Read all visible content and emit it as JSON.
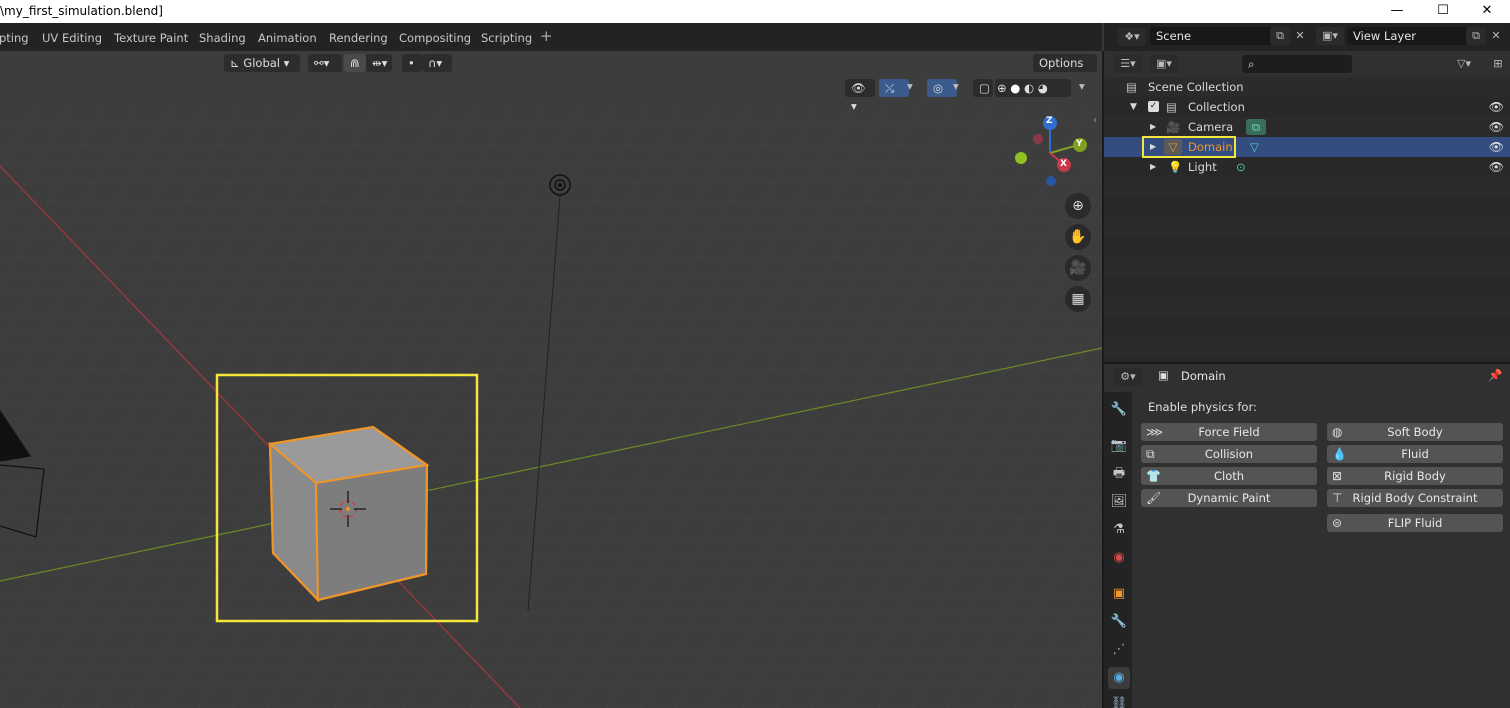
{
  "window": {
    "title": "\\my_first_simulation.blend]",
    "minimize": "—",
    "maximize": "☐",
    "close": "✕"
  },
  "workspace_tabs": [
    "pting",
    "UV Editing",
    "Texture Paint",
    "Shading",
    "Animation",
    "Rendering",
    "Compositing",
    "Scripting",
    "+"
  ],
  "scene": {
    "label": "Scene",
    "view_layer": "View Layer"
  },
  "viewport": {
    "transform_orientation": "Global",
    "options_label": "Options",
    "gizmo_axes": {
      "z": "Z",
      "y": "Y",
      "x": "X"
    }
  },
  "outliner": {
    "search_placeholder": "",
    "rows": [
      {
        "label": "Scene Collection"
      },
      {
        "label": "Collection"
      },
      {
        "label": "Camera"
      },
      {
        "label": "Domain"
      },
      {
        "label": "Light"
      }
    ]
  },
  "properties": {
    "object_name": "Domain",
    "enable_physics_label": "Enable physics for:",
    "left_buttons": [
      "Force Field",
      "Collision",
      "Cloth",
      "Dynamic Paint"
    ],
    "right_buttons": [
      "Soft Body",
      "Fluid",
      "Rigid Body",
      "Rigid Body Constraint",
      "FLIP Fluid"
    ]
  },
  "colors": {
    "highlight_box": "#f5e63c",
    "selection_orange": "#f0952a",
    "selected_row": "#334d80",
    "x_axis": "#c83a4a",
    "y_axis": "#7fa020",
    "z_axis": "#2f6fd0"
  }
}
